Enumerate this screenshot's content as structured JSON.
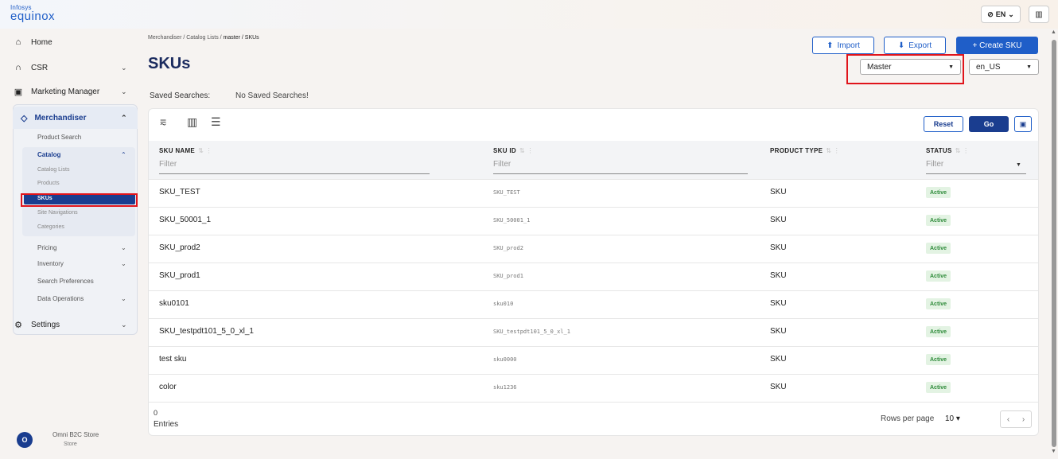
{
  "brand": {
    "line1": "Infosys",
    "line2": "equinox"
  },
  "header": {
    "language": "EN",
    "language_caret": "⌄",
    "globe_icon": "globe-icon",
    "layout_icon": "layout-icon"
  },
  "sidebar": {
    "home": "Home",
    "csr": "CSR",
    "marketing": "Marketing Manager",
    "merchandiser": "Merchandiser",
    "product_search": "Product Search",
    "catalog": "Catalog",
    "catalog_lists": "Catalog Lists",
    "products": "Products",
    "skus": "SKUs",
    "site_navigations": "Site Navigations",
    "categories": "Categories",
    "pricing": "Pricing",
    "inventory": "Inventory",
    "search_preferences": "Search Preferences",
    "data_operations": "Data Operations",
    "settings": "Settings",
    "store_initial": "O",
    "store_name": "Omni B2C Store",
    "store_sub": "Store"
  },
  "breadcrumb": {
    "parts": "Merchandiser / Catalog Lists / ",
    "current": "master / SKUs"
  },
  "page": {
    "title": "SKUs"
  },
  "actions": {
    "import": "Import",
    "export": "Export",
    "create": "+ Create SKU"
  },
  "selectors": {
    "catalog": "Master",
    "locale": "en_US"
  },
  "saved_searches": {
    "label": "Saved Searches:",
    "value": "No Saved Searches!"
  },
  "toolbar": {
    "reset": "Reset",
    "go": "Go"
  },
  "table": {
    "columns": {
      "name": "SKU NAME",
      "id": "SKU ID",
      "type": "PRODUCT TYPE",
      "status": "STATUS"
    },
    "filter_placeholder": "Filter",
    "rows": [
      {
        "name": "SKU_TEST",
        "id": "SKU_TEST",
        "type": "SKU",
        "status": "Active"
      },
      {
        "name": "SKU_50001_1",
        "id": "SKU_50001_1",
        "type": "SKU",
        "status": "Active"
      },
      {
        "name": "SKU_prod2",
        "id": "SKU_prod2",
        "type": "SKU",
        "status": "Active"
      },
      {
        "name": "SKU_prod1",
        "id": "SKU_prod1",
        "type": "SKU",
        "status": "Active"
      },
      {
        "name": "sku0101",
        "id": "sku010",
        "type": "SKU",
        "status": "Active"
      },
      {
        "name": "SKU_testpdt101_5_0_xl_1",
        "id": "SKU_testpdt101_5_0_xl_1",
        "type": "SKU",
        "status": "Active"
      },
      {
        "name": "test sku",
        "id": "sku0000",
        "type": "SKU",
        "status": "Active"
      },
      {
        "name": "color",
        "id": "sku1236",
        "type": "SKU",
        "status": "Active"
      }
    ]
  },
  "footer": {
    "count": "0",
    "entries_label": "Entries",
    "rows_per_page_label": "Rows per page",
    "rows_per_page": "10"
  },
  "colors": {
    "primary": "#1f5ec8",
    "navy": "#1a3d8f",
    "highlight": "#e0141b",
    "active_badge": "#2e8b3a"
  }
}
